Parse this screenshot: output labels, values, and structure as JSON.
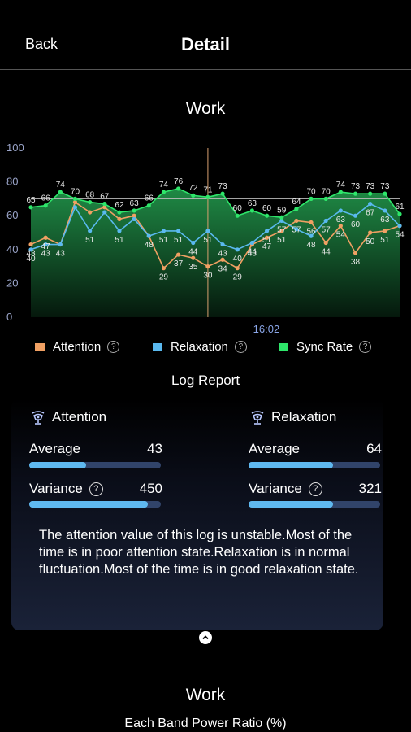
{
  "header": {
    "back_label": "Back",
    "title": "Detail"
  },
  "chart_section": {
    "title": "Work"
  },
  "chart_data": {
    "type": "line",
    "ylim": [
      0,
      100
    ],
    "yticks": [
      "100",
      "80",
      "60",
      "40",
      "20",
      "0"
    ],
    "x_marker_label": "16:02",
    "reference_line": 70,
    "series": [
      {
        "name": "Sync Rate",
        "color": "#2ee66a",
        "values": [
          65,
          66,
          74,
          70,
          68,
          67,
          62,
          63,
          66,
          74,
          76,
          72,
          71,
          73,
          60,
          63,
          60,
          59,
          64,
          70,
          70,
          74,
          73,
          73,
          73,
          61
        ]
      },
      {
        "name": "Relaxation",
        "color": "#5ab9ef",
        "values": [
          40,
          43,
          43,
          65,
          51,
          62,
          51,
          58,
          48,
          51,
          51,
          44,
          51,
          43,
          40,
          44,
          51,
          57,
          52,
          48,
          57,
          63,
          60,
          67,
          63,
          54
        ]
      },
      {
        "name": "Attention",
        "color": "#f0a063",
        "values": [
          43,
          47,
          43,
          68,
          62,
          65,
          58,
          60,
          48,
          29,
          37,
          35,
          30,
          34,
          29,
          43,
          47,
          51,
          57,
          56,
          44,
          54,
          38,
          50,
          51,
          54
        ]
      }
    ],
    "point_labels": [
      {
        "v": "65",
        "s": 0,
        "i": 0
      },
      {
        "v": "66",
        "s": 0,
        "i": 1
      },
      {
        "v": "74",
        "s": 0,
        "i": 2
      },
      {
        "v": "70",
        "s": 0,
        "i": 3
      },
      {
        "v": "68",
        "s": 0,
        "i": 4
      },
      {
        "v": "67",
        "s": 0,
        "i": 5
      },
      {
        "v": "62",
        "s": 0,
        "i": 6
      },
      {
        "v": "63",
        "s": 0,
        "i": 7
      },
      {
        "v": "66",
        "s": 0,
        "i": 8
      },
      {
        "v": "74",
        "s": 0,
        "i": 9
      },
      {
        "v": "76",
        "s": 0,
        "i": 10
      },
      {
        "v": "72",
        "s": 0,
        "i": 11
      },
      {
        "v": "71",
        "s": 0,
        "i": 12
      },
      {
        "v": "73",
        "s": 0,
        "i": 13
      },
      {
        "v": "60",
        "s": 0,
        "i": 14
      },
      {
        "v": "63",
        "s": 0,
        "i": 15
      },
      {
        "v": "60",
        "s": 0,
        "i": 16
      },
      {
        "v": "59",
        "s": 0,
        "i": 17
      },
      {
        "v": "64",
        "s": 0,
        "i": 18
      },
      {
        "v": "70",
        "s": 0,
        "i": 19
      },
      {
        "v": "70",
        "s": 0,
        "i": 20
      },
      {
        "v": "74",
        "s": 0,
        "i": 21
      },
      {
        "v": "73",
        "s": 0,
        "i": 22
      },
      {
        "v": "73",
        "s": 0,
        "i": 23
      },
      {
        "v": "73",
        "s": 0,
        "i": 24
      },
      {
        "v": "61",
        "s": 0,
        "i": 25
      },
      {
        "v": "40",
        "s": 1,
        "i": 0
      },
      {
        "v": "43",
        "s": 1,
        "i": 1
      },
      {
        "v": "43",
        "s": 1,
        "i": 2
      },
      {
        "v": "51",
        "s": 1,
        "i": 4
      },
      {
        "v": "51",
        "s": 1,
        "i": 6
      },
      {
        "v": "48",
        "s": 1,
        "i": 8
      },
      {
        "v": "51",
        "s": 1,
        "i": 9
      },
      {
        "v": "51",
        "s": 1,
        "i": 10
      },
      {
        "v": "44",
        "s": 1,
        "i": 11
      },
      {
        "v": "51",
        "s": 1,
        "i": 12
      },
      {
        "v": "43",
        "s": 1,
        "i": 13
      },
      {
        "v": "40",
        "s": 1,
        "i": 14
      },
      {
        "v": "44",
        "s": 1,
        "i": 15
      },
      {
        "v": "51",
        "s": 1,
        "i": 16
      },
      {
        "v": "57",
        "s": 1,
        "i": 17
      },
      {
        "v": "48",
        "s": 1,
        "i": 19
      },
      {
        "v": "57",
        "s": 1,
        "i": 20
      },
      {
        "v": "63",
        "s": 1,
        "i": 21
      },
      {
        "v": "60",
        "s": 1,
        "i": 22
      },
      {
        "v": "67",
        "s": 1,
        "i": 23
      },
      {
        "v": "63",
        "s": 1,
        "i": 24
      },
      {
        "v": "54",
        "s": 1,
        "i": 25
      },
      {
        "v": "43",
        "s": 2,
        "i": 0
      },
      {
        "v": "47",
        "s": 2,
        "i": 1
      },
      {
        "v": "29",
        "s": 2,
        "i": 9
      },
      {
        "v": "37",
        "s": 2,
        "i": 10
      },
      {
        "v": "35",
        "s": 2,
        "i": 11
      },
      {
        "v": "30",
        "s": 2,
        "i": 12
      },
      {
        "v": "34",
        "s": 2,
        "i": 13
      },
      {
        "v": "29",
        "s": 2,
        "i": 14
      },
      {
        "v": "43",
        "s": 2,
        "i": 15
      },
      {
        "v": "47",
        "s": 2,
        "i": 16
      },
      {
        "v": "51",
        "s": 2,
        "i": 17
      },
      {
        "v": "57",
        "s": 2,
        "i": 18
      },
      {
        "v": "56",
        "s": 2,
        "i": 19
      },
      {
        "v": "44",
        "s": 2,
        "i": 20
      },
      {
        "v": "54",
        "s": 2,
        "i": 21
      },
      {
        "v": "38",
        "s": 2,
        "i": 22
      },
      {
        "v": "50",
        "s": 2,
        "i": 23
      },
      {
        "v": "51",
        "s": 2,
        "i": 24
      }
    ]
  },
  "legend": [
    {
      "label": "Attention",
      "color": "#f0a063"
    },
    {
      "label": "Relaxation",
      "color": "#5ab9ef"
    },
    {
      "label": "Sync Rate",
      "color": "#2ee66a"
    }
  ],
  "log_report": {
    "title": "Log Report",
    "attention": {
      "title": "Attention",
      "average_label": "Average",
      "average": "43",
      "average_fraction": 0.43,
      "variance_label": "Variance",
      "variance": "450",
      "variance_fraction": 0.9
    },
    "relaxation": {
      "title": "Relaxation",
      "average_label": "Average",
      "average": "64",
      "average_fraction": 0.64,
      "variance_label": "Variance",
      "variance": "321",
      "variance_fraction": 0.64
    },
    "summary": "The attention value of this log is unstable.Most of the time is in poor attention state.Relaxation is in normal fluctuation.Most of the time is in good relaxation state."
  },
  "band_section": {
    "title": "Work",
    "subtitle": "Each Band Power Ratio (%)"
  },
  "icons": {
    "help": "?",
    "collapse": "chevron-up-icon",
    "lamp": "lamp-icon"
  }
}
